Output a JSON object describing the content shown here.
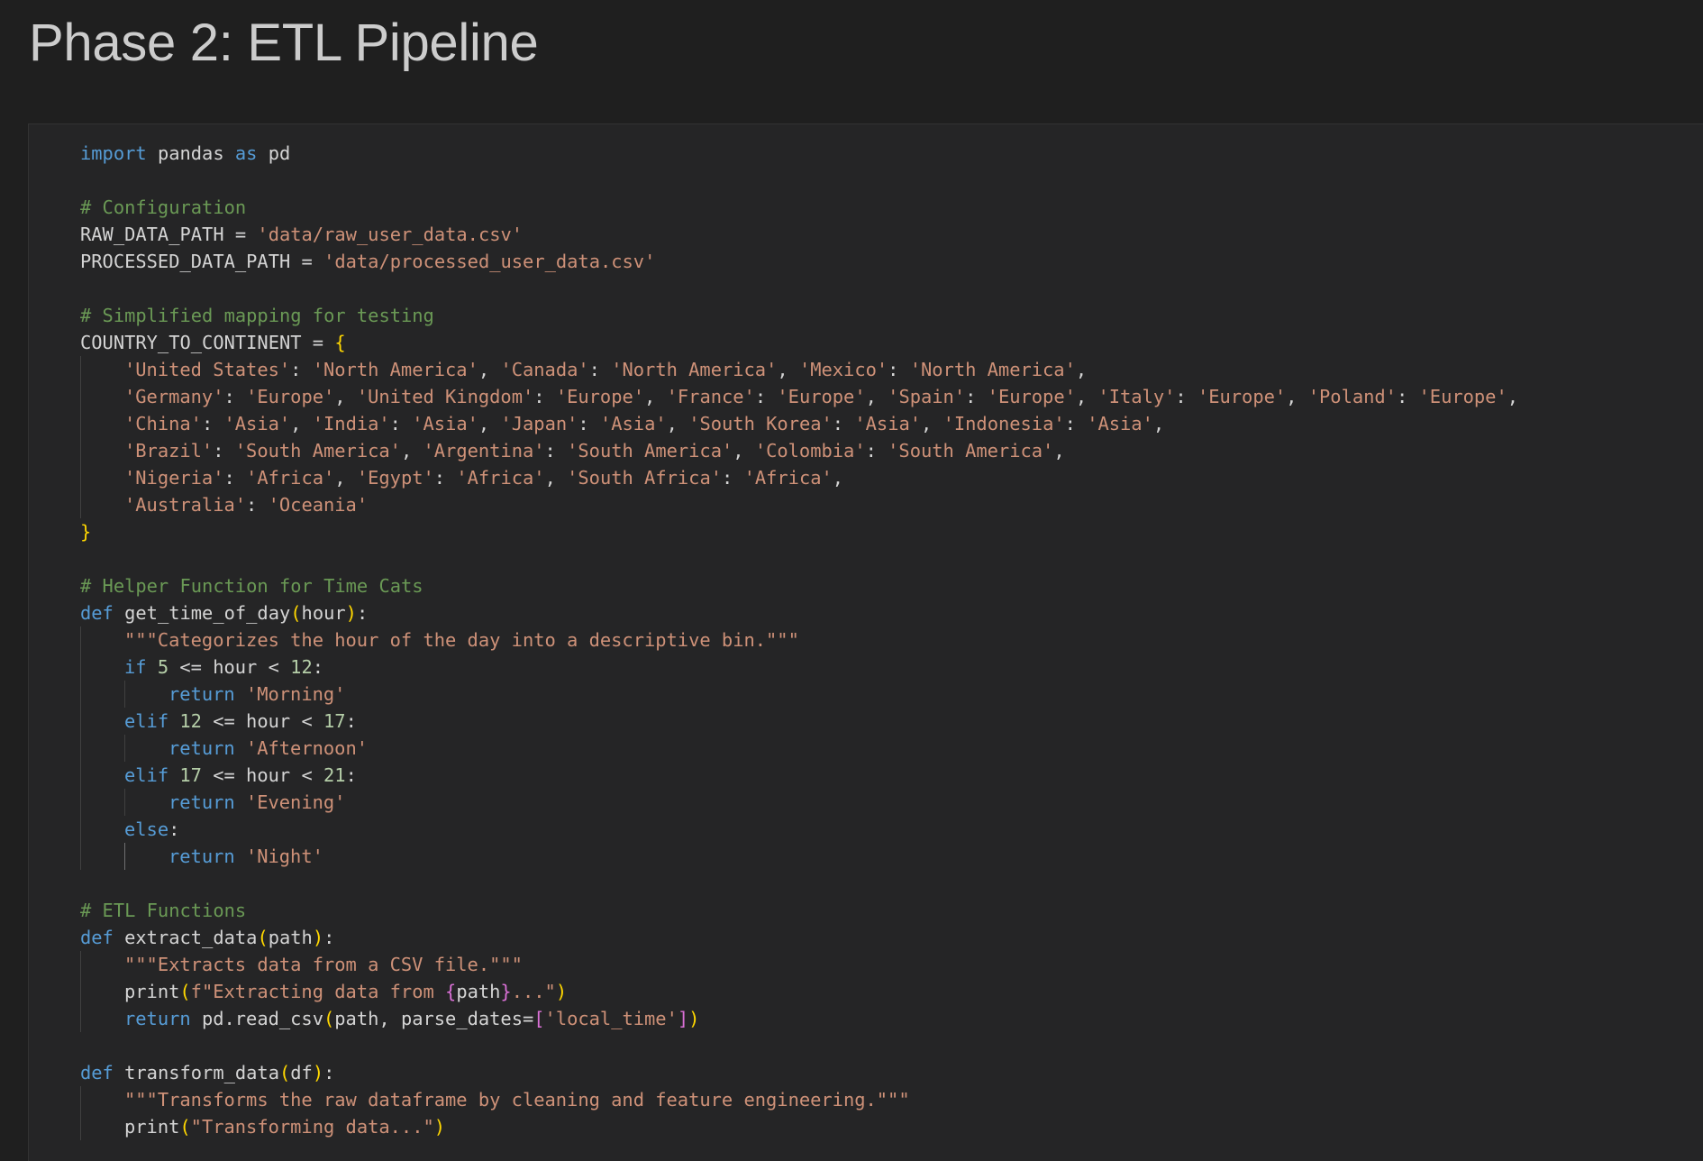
{
  "page": {
    "title": "Phase 2: ETL Pipeline"
  },
  "code": {
    "language": "python",
    "lines": [
      [
        [
          "kw",
          "import"
        ],
        [
          "pl",
          " pandas "
        ],
        [
          "kw",
          "as"
        ],
        [
          "pl",
          " pd"
        ]
      ],
      [],
      [
        [
          "cm",
          "# Configuration"
        ]
      ],
      [
        [
          "pl",
          "RAW_DATA_PATH = "
        ],
        [
          "st",
          "'data/raw_user_data.csv'"
        ]
      ],
      [
        [
          "pl",
          "PROCESSED_DATA_PATH = "
        ],
        [
          "st",
          "'data/processed_user_data.csv'"
        ]
      ],
      [],
      [
        [
          "cm",
          "# Simplified mapping for testing"
        ]
      ],
      [
        [
          "pl",
          "COUNTRY_TO_CONTINENT = "
        ],
        [
          "br",
          "{"
        ]
      ],
      [
        [
          "ind",
          ""
        ],
        [
          "st",
          "'United States'"
        ],
        [
          "pl",
          ": "
        ],
        [
          "st",
          "'North America'"
        ],
        [
          "pl",
          ", "
        ],
        [
          "st",
          "'Canada'"
        ],
        [
          "pl",
          ": "
        ],
        [
          "st",
          "'North America'"
        ],
        [
          "pl",
          ", "
        ],
        [
          "st",
          "'Mexico'"
        ],
        [
          "pl",
          ": "
        ],
        [
          "st",
          "'North America'"
        ],
        [
          "pl",
          ","
        ]
      ],
      [
        [
          "ind",
          ""
        ],
        [
          "st",
          "'Germany'"
        ],
        [
          "pl",
          ": "
        ],
        [
          "st",
          "'Europe'"
        ],
        [
          "pl",
          ", "
        ],
        [
          "st",
          "'United Kingdom'"
        ],
        [
          "pl",
          ": "
        ],
        [
          "st",
          "'Europe'"
        ],
        [
          "pl",
          ", "
        ],
        [
          "st",
          "'France'"
        ],
        [
          "pl",
          ": "
        ],
        [
          "st",
          "'Europe'"
        ],
        [
          "pl",
          ", "
        ],
        [
          "st",
          "'Spain'"
        ],
        [
          "pl",
          ": "
        ],
        [
          "st",
          "'Europe'"
        ],
        [
          "pl",
          ", "
        ],
        [
          "st",
          "'Italy'"
        ],
        [
          "pl",
          ": "
        ],
        [
          "st",
          "'Europe'"
        ],
        [
          "pl",
          ", "
        ],
        [
          "st",
          "'Poland'"
        ],
        [
          "pl",
          ": "
        ],
        [
          "st",
          "'Europe'"
        ],
        [
          "pl",
          ","
        ]
      ],
      [
        [
          "ind",
          ""
        ],
        [
          "st",
          "'China'"
        ],
        [
          "pl",
          ": "
        ],
        [
          "st",
          "'Asia'"
        ],
        [
          "pl",
          ", "
        ],
        [
          "st",
          "'India'"
        ],
        [
          "pl",
          ": "
        ],
        [
          "st",
          "'Asia'"
        ],
        [
          "pl",
          ", "
        ],
        [
          "st",
          "'Japan'"
        ],
        [
          "pl",
          ": "
        ],
        [
          "st",
          "'Asia'"
        ],
        [
          "pl",
          ", "
        ],
        [
          "st",
          "'South Korea'"
        ],
        [
          "pl",
          ": "
        ],
        [
          "st",
          "'Asia'"
        ],
        [
          "pl",
          ", "
        ],
        [
          "st",
          "'Indonesia'"
        ],
        [
          "pl",
          ": "
        ],
        [
          "st",
          "'Asia'"
        ],
        [
          "pl",
          ","
        ]
      ],
      [
        [
          "ind",
          ""
        ],
        [
          "st",
          "'Brazil'"
        ],
        [
          "pl",
          ": "
        ],
        [
          "st",
          "'South America'"
        ],
        [
          "pl",
          ", "
        ],
        [
          "st",
          "'Argentina'"
        ],
        [
          "pl",
          ": "
        ],
        [
          "st",
          "'South America'"
        ],
        [
          "pl",
          ", "
        ],
        [
          "st",
          "'Colombia'"
        ],
        [
          "pl",
          ": "
        ],
        [
          "st",
          "'South America'"
        ],
        [
          "pl",
          ","
        ]
      ],
      [
        [
          "ind",
          ""
        ],
        [
          "st",
          "'Nigeria'"
        ],
        [
          "pl",
          ": "
        ],
        [
          "st",
          "'Africa'"
        ],
        [
          "pl",
          ", "
        ],
        [
          "st",
          "'Egypt'"
        ],
        [
          "pl",
          ": "
        ],
        [
          "st",
          "'Africa'"
        ],
        [
          "pl",
          ", "
        ],
        [
          "st",
          "'South Africa'"
        ],
        [
          "pl",
          ": "
        ],
        [
          "st",
          "'Africa'"
        ],
        [
          "pl",
          ","
        ]
      ],
      [
        [
          "ind",
          ""
        ],
        [
          "st",
          "'Australia'"
        ],
        [
          "pl",
          ": "
        ],
        [
          "st",
          "'Oceania'"
        ]
      ],
      [
        [
          "br",
          "}"
        ]
      ],
      [],
      [
        [
          "cm",
          "# Helper Function for Time Cats"
        ]
      ],
      [
        [
          "kw",
          "def"
        ],
        [
          "pl",
          " get_time_of_day"
        ],
        [
          "br",
          "("
        ],
        [
          "pl",
          "hour"
        ],
        [
          "br",
          ")"
        ],
        [
          "pl",
          ":"
        ]
      ],
      [
        [
          "ind",
          ""
        ],
        [
          "st",
          "\"\"\"Categorizes the hour of the day into a descriptive bin.\"\"\""
        ]
      ],
      [
        [
          "ind",
          ""
        ],
        [
          "kw",
          "if"
        ],
        [
          "pl",
          " "
        ],
        [
          "nm",
          "5"
        ],
        [
          "pl",
          " <= hour < "
        ],
        [
          "nm",
          "12"
        ],
        [
          "pl",
          ":"
        ]
      ],
      [
        [
          "ind",
          ""
        ],
        [
          "ind",
          ""
        ],
        [
          "kw",
          "return"
        ],
        [
          "pl",
          " "
        ],
        [
          "st",
          "'Morning'"
        ]
      ],
      [
        [
          "ind",
          ""
        ],
        [
          "kw",
          "elif"
        ],
        [
          "pl",
          " "
        ],
        [
          "nm",
          "12"
        ],
        [
          "pl",
          " <= hour < "
        ],
        [
          "nm",
          "17"
        ],
        [
          "pl",
          ":"
        ]
      ],
      [
        [
          "ind",
          ""
        ],
        [
          "ind",
          ""
        ],
        [
          "kw",
          "return"
        ],
        [
          "pl",
          " "
        ],
        [
          "st",
          "'Afternoon'"
        ]
      ],
      [
        [
          "ind",
          ""
        ],
        [
          "kw",
          "elif"
        ],
        [
          "pl",
          " "
        ],
        [
          "nm",
          "17"
        ],
        [
          "pl",
          " <= hour < "
        ],
        [
          "nm",
          "21"
        ],
        [
          "pl",
          ":"
        ]
      ],
      [
        [
          "ind",
          ""
        ],
        [
          "ind",
          ""
        ],
        [
          "kw",
          "return"
        ],
        [
          "pl",
          " "
        ],
        [
          "st",
          "'Evening'"
        ]
      ],
      [
        [
          "ind",
          ""
        ],
        [
          "kw",
          "else"
        ],
        [
          "pl",
          ":"
        ]
      ],
      [
        [
          "ind",
          ""
        ],
        [
          "hot",
          ""
        ],
        [
          "kw",
          "return"
        ],
        [
          "pl",
          " "
        ],
        [
          "st",
          "'Night'"
        ]
      ],
      [],
      [
        [
          "cm",
          "# ETL Functions"
        ]
      ],
      [
        [
          "kw",
          "def"
        ],
        [
          "pl",
          " extract_data"
        ],
        [
          "br",
          "("
        ],
        [
          "pl",
          "path"
        ],
        [
          "br",
          ")"
        ],
        [
          "pl",
          ":"
        ]
      ],
      [
        [
          "ind",
          ""
        ],
        [
          "st",
          "\"\"\"Extracts data from a CSV file.\"\"\""
        ]
      ],
      [
        [
          "ind",
          ""
        ],
        [
          "pl",
          "print"
        ],
        [
          "br",
          "("
        ],
        [
          "st",
          "f\"Extracting data from "
        ],
        [
          "br2",
          "{"
        ],
        [
          "pl",
          "path"
        ],
        [
          "br2",
          "}"
        ],
        [
          "st",
          "...\""
        ],
        [
          "br",
          ")"
        ]
      ],
      [
        [
          "ind",
          ""
        ],
        [
          "kw",
          "return"
        ],
        [
          "pl",
          " pd.read_csv"
        ],
        [
          "br",
          "("
        ],
        [
          "pl",
          "path, parse_dates="
        ],
        [
          "br2",
          "["
        ],
        [
          "st",
          "'local_time'"
        ],
        [
          "br2",
          "]"
        ],
        [
          "br",
          ")"
        ]
      ],
      [],
      [
        [
          "kw",
          "def"
        ],
        [
          "pl",
          " transform_data"
        ],
        [
          "br",
          "("
        ],
        [
          "pl",
          "df"
        ],
        [
          "br",
          ")"
        ],
        [
          "pl",
          ":"
        ]
      ],
      [
        [
          "ind",
          ""
        ],
        [
          "st",
          "\"\"\"Transforms the raw dataframe by cleaning and feature engineering.\"\"\""
        ]
      ],
      [
        [
          "ind",
          ""
        ],
        [
          "pl",
          "print"
        ],
        [
          "br",
          "("
        ],
        [
          "st",
          "\"Transforming data...\""
        ],
        [
          "br",
          ")"
        ]
      ]
    ]
  }
}
